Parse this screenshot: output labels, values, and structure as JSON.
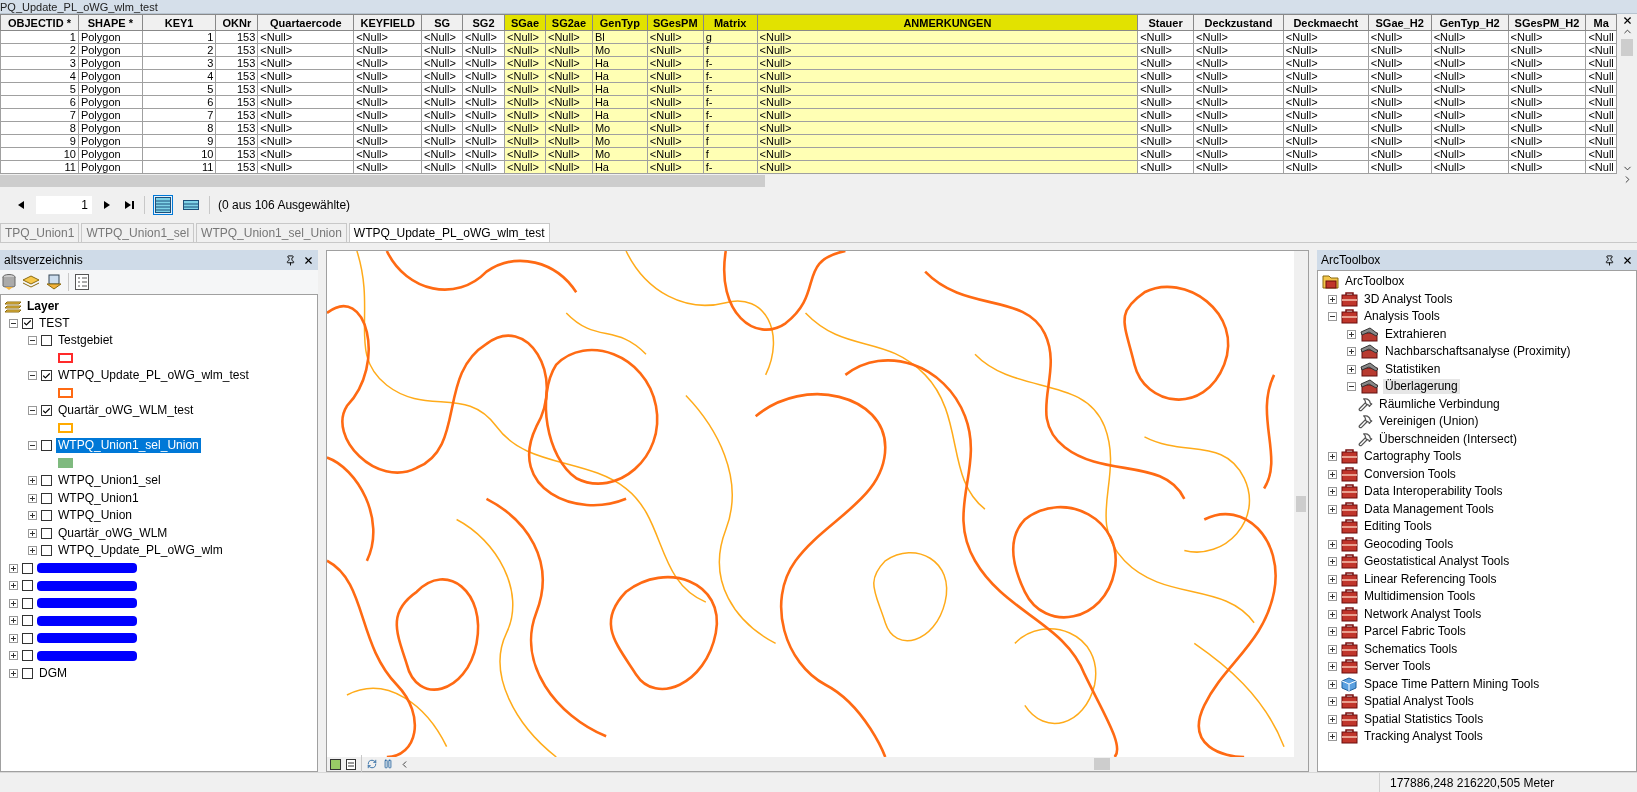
{
  "window": {
    "title": "PQ_Update_PL_oWG_wlm_test"
  },
  "table": {
    "columns": [
      {
        "label": "OBJECTID *",
        "highlighted": false
      },
      {
        "label": "SHAPE *",
        "highlighted": false
      },
      {
        "label": "KEY1",
        "highlighted": false
      },
      {
        "label": "OKNr",
        "highlighted": false
      },
      {
        "label": "Quartaercode",
        "highlighted": false
      },
      {
        "label": "KEYFIELD",
        "highlighted": false
      },
      {
        "label": "SG",
        "highlighted": false
      },
      {
        "label": "SG2",
        "highlighted": false
      },
      {
        "label": "SGae",
        "highlighted": true
      },
      {
        "label": "SG2ae",
        "highlighted": true
      },
      {
        "label": "GenTyp",
        "highlighted": true
      },
      {
        "label": "SGesPM",
        "highlighted": true
      },
      {
        "label": "Matrix",
        "highlighted": true
      },
      {
        "label": "ANMERKUNGEN",
        "highlighted": true
      },
      {
        "label": "Stauer",
        "highlighted": false
      },
      {
        "label": "Deckzustand",
        "highlighted": false
      },
      {
        "label": "Deckmaecht",
        "highlighted": false
      },
      {
        "label": "SGae_H2",
        "highlighted": false
      },
      {
        "label": "GenTyp_H2",
        "highlighted": false
      },
      {
        "label": "SGesPM_H2",
        "highlighted": false
      },
      {
        "label": "Ma",
        "highlighted": false
      }
    ],
    "rows": [
      [
        "1",
        "Polygon",
        "1",
        "153",
        "<Null>",
        "<Null>",
        "<Null>",
        "<Null>",
        "<Null>",
        "<Null>",
        "Bl",
        "<Null>",
        "g",
        "<Null>",
        "<Null>",
        "<Null>",
        "<Null>",
        "<Null>",
        "<Null>",
        "<Null>",
        "<Null"
      ],
      [
        "2",
        "Polygon",
        "2",
        "153",
        "<Null>",
        "<Null>",
        "<Null>",
        "<Null>",
        "<Null>",
        "<Null>",
        "Mo",
        "<Null>",
        "f",
        "<Null>",
        "<Null>",
        "<Null>",
        "<Null>",
        "<Null>",
        "<Null>",
        "<Null>",
        "<Null"
      ],
      [
        "3",
        "Polygon",
        "3",
        "153",
        "<Null>",
        "<Null>",
        "<Null>",
        "<Null>",
        "<Null>",
        "<Null>",
        "Ha",
        "<Null>",
        "f-",
        "<Null>",
        "<Null>",
        "<Null>",
        "<Null>",
        "<Null>",
        "<Null>",
        "<Null>",
        "<Null"
      ],
      [
        "4",
        "Polygon",
        "4",
        "153",
        "<Null>",
        "<Null>",
        "<Null>",
        "<Null>",
        "<Null>",
        "<Null>",
        "Ha",
        "<Null>",
        "f-",
        "<Null>",
        "<Null>",
        "<Null>",
        "<Null>",
        "<Null>",
        "<Null>",
        "<Null>",
        "<Null"
      ],
      [
        "5",
        "Polygon",
        "5",
        "153",
        "<Null>",
        "<Null>",
        "<Null>",
        "<Null>",
        "<Null>",
        "<Null>",
        "Ha",
        "<Null>",
        "f-",
        "<Null>",
        "<Null>",
        "<Null>",
        "<Null>",
        "<Null>",
        "<Null>",
        "<Null>",
        "<Null"
      ],
      [
        "6",
        "Polygon",
        "6",
        "153",
        "<Null>",
        "<Null>",
        "<Null>",
        "<Null>",
        "<Null>",
        "<Null>",
        "Ha",
        "<Null>",
        "f-",
        "<Null>",
        "<Null>",
        "<Null>",
        "<Null>",
        "<Null>",
        "<Null>",
        "<Null>",
        "<Null"
      ],
      [
        "7",
        "Polygon",
        "7",
        "153",
        "<Null>",
        "<Null>",
        "<Null>",
        "<Null>",
        "<Null>",
        "<Null>",
        "Ha",
        "<Null>",
        "f-",
        "<Null>",
        "<Null>",
        "<Null>",
        "<Null>",
        "<Null>",
        "<Null>",
        "<Null>",
        "<Null"
      ],
      [
        "8",
        "Polygon",
        "8",
        "153",
        "<Null>",
        "<Null>",
        "<Null>",
        "<Null>",
        "<Null>",
        "<Null>",
        "Mo",
        "<Null>",
        "f",
        "<Null>",
        "<Null>",
        "<Null>",
        "<Null>",
        "<Null>",
        "<Null>",
        "<Null>",
        "<Null"
      ],
      [
        "9",
        "Polygon",
        "9",
        "153",
        "<Null>",
        "<Null>",
        "<Null>",
        "<Null>",
        "<Null>",
        "<Null>",
        "Mo",
        "<Null>",
        "f",
        "<Null>",
        "<Null>",
        "<Null>",
        "<Null>",
        "<Null>",
        "<Null>",
        "<Null>",
        "<Null"
      ],
      [
        "10",
        "Polygon",
        "10",
        "153",
        "<Null>",
        "<Null>",
        "<Null>",
        "<Null>",
        "<Null>",
        "<Null>",
        "Mo",
        "<Null>",
        "f",
        "<Null>",
        "<Null>",
        "<Null>",
        "<Null>",
        "<Null>",
        "<Null>",
        "<Null>",
        "<Null"
      ],
      [
        "11",
        "Polygon",
        "11",
        "153",
        "<Null>",
        "<Null>",
        "<Null>",
        "<Null>",
        "<Null>",
        "<Null>",
        "Ha",
        "<Null>",
        "f-",
        "<Null>",
        "<Null>",
        "<Null>",
        "<Null>",
        "<Null>",
        "<Null>",
        "<Null>",
        "<Null"
      ]
    ]
  },
  "navigator": {
    "record": "1",
    "views": [
      {
        "selected": true
      },
      {
        "selected": false
      }
    ],
    "selection_info": "(0 aus 106 Ausgewählte)"
  },
  "tabs": [
    {
      "label": "TPQ_Union1",
      "selected": false
    },
    {
      "label": "WTPQ_Union1_sel",
      "selected": false
    },
    {
      "label": "WTPQ_Union1_sel_Union",
      "selected": false
    },
    {
      "label": "WTPQ_Update_PL_oWG_wlm_test",
      "selected": true
    }
  ],
  "toc": {
    "title": "altsverzeichnis",
    "root": {
      "label": "Layer",
      "children": [
        {
          "kind": "group",
          "label": "TEST",
          "checked": true,
          "expanded": true,
          "selected": false,
          "children": [
            {
              "kind": "layer",
              "label": "Testgebiet",
              "checked": false,
              "expanded": true,
              "selected": false,
              "symbol": {
                "color": "#ff2a2a",
                "filled": false
              }
            },
            {
              "kind": "layer",
              "label": "WTPQ_Update_PL_oWG_wlm_test",
              "checked": true,
              "expanded": true,
              "selected": false,
              "symbol": {
                "color": "#ff6a13",
                "filled": false
              }
            },
            {
              "kind": "layer",
              "label": "Quartär_oWG_WLM_test",
              "checked": true,
              "expanded": true,
              "selected": false,
              "symbol": {
                "color": "#ffaa00",
                "filled": false
              }
            },
            {
              "kind": "layer",
              "label": "WTPQ_Union1_sel_Union",
              "checked": false,
              "expanded": true,
              "selected": true,
              "symbol": {
                "color": "#7fba7f",
                "filled": true
              }
            },
            {
              "kind": "layer",
              "label": "WTPQ_Union1_sel",
              "checked": false,
              "expanded": false,
              "selected": false
            },
            {
              "kind": "layer",
              "label": "WTPQ_Union1",
              "checked": false,
              "expanded": false,
              "selected": false
            },
            {
              "kind": "layer",
              "label": "WTPQ_Union",
              "checked": false,
              "expanded": false,
              "selected": false
            },
            {
              "kind": "layer",
              "label": "Quartär_oWG_WLM",
              "checked": false,
              "expanded": false,
              "selected": false
            },
            {
              "kind": "layer",
              "label": "WTPQ_Update_PL_oWG_wlm",
              "checked": false,
              "expanded": false,
              "selected": false
            }
          ]
        },
        {
          "kind": "redacted",
          "checked": false,
          "expanded": false
        },
        {
          "kind": "redacted",
          "checked": false,
          "expanded": false
        },
        {
          "kind": "redacted",
          "checked": false,
          "expanded": false
        },
        {
          "kind": "redacted",
          "checked": false,
          "expanded": false
        },
        {
          "kind": "redacted",
          "checked": false,
          "expanded": false
        },
        {
          "kind": "redacted",
          "checked": false,
          "expanded": false
        },
        {
          "kind": "group",
          "label": "DGM",
          "checked": false,
          "expanded": false,
          "selected": false
        }
      ]
    }
  },
  "toolbox": {
    "title": "ArcToolbox",
    "root": {
      "label": "ArcToolbox",
      "children": [
        {
          "kind": "toolbox",
          "label": "3D Analyst Tools",
          "expandable": true,
          "expanded": false,
          "selected": false
        },
        {
          "kind": "toolbox",
          "label": "Analysis Tools",
          "expandable": true,
          "expanded": true,
          "selected": false,
          "children": [
            {
              "kind": "toolset",
              "label": "Extrahieren",
              "expandable": true,
              "expanded": false,
              "selected": false
            },
            {
              "kind": "toolset",
              "label": "Nachbarschaftsanalyse (Proximity)",
              "expandable": true,
              "expanded": false,
              "selected": false
            },
            {
              "kind": "toolset",
              "label": "Statistiken",
              "expandable": true,
              "expanded": false,
              "selected": false
            },
            {
              "kind": "toolset",
              "label": "Überlagerung",
              "expandable": true,
              "expanded": true,
              "selected": true,
              "children": [
                {
                  "kind": "tool",
                  "label": "Räumliche Verbindung",
                  "selected": false
                },
                {
                  "kind": "tool",
                  "label": "Vereinigen (Union)",
                  "selected": false
                },
                {
                  "kind": "tool",
                  "label": "Überschneiden (Intersect)",
                  "selected": false
                }
              ]
            }
          ]
        },
        {
          "kind": "toolbox",
          "label": "Cartography Tools",
          "expandable": true,
          "expanded": false,
          "selected": false
        },
        {
          "kind": "toolbox",
          "label": "Conversion Tools",
          "expandable": true,
          "expanded": false,
          "selected": false
        },
        {
          "kind": "toolbox",
          "label": "Data Interoperability Tools",
          "expandable": true,
          "expanded": false,
          "selected": false
        },
        {
          "kind": "toolbox",
          "label": "Data Management Tools",
          "expandable": true,
          "expanded": false,
          "selected": false
        },
        {
          "kind": "toolbox",
          "label": "Editing Tools",
          "expandable": false,
          "selected": false
        },
        {
          "kind": "toolbox",
          "label": "Geocoding Tools",
          "expandable": true,
          "expanded": false,
          "selected": false
        },
        {
          "kind": "toolbox",
          "label": "Geostatistical Analyst Tools",
          "expandable": true,
          "expanded": false,
          "selected": false
        },
        {
          "kind": "toolbox",
          "label": "Linear Referencing Tools",
          "expandable": true,
          "expanded": false,
          "selected": false
        },
        {
          "kind": "toolbox",
          "label": "Multidimension Tools",
          "expandable": true,
          "expanded": false,
          "selected": false
        },
        {
          "kind": "toolbox",
          "label": "Network Analyst Tools",
          "expandable": true,
          "expanded": false,
          "selected": false
        },
        {
          "kind": "toolbox",
          "label": "Parcel Fabric Tools",
          "expandable": true,
          "expanded": false,
          "selected": false
        },
        {
          "kind": "toolbox",
          "label": "Schematics Tools",
          "expandable": true,
          "expanded": false,
          "selected": false
        },
        {
          "kind": "toolbox",
          "label": "Server Tools",
          "expandable": true,
          "expanded": false,
          "selected": false
        },
        {
          "kind": "script-toolbox",
          "label": "Space Time Pattern Mining Tools",
          "expandable": true,
          "expanded": false,
          "selected": false
        },
        {
          "kind": "toolbox",
          "label": "Spatial Analyst Tools",
          "expandable": true,
          "expanded": false,
          "selected": false
        },
        {
          "kind": "toolbox",
          "label": "Spatial Statistics Tools",
          "expandable": true,
          "expanded": false,
          "selected": false
        },
        {
          "kind": "toolbox",
          "label": "Tracking Analyst Tools",
          "expandable": true,
          "expanded": false,
          "selected": false
        }
      ]
    }
  },
  "status_bar": {
    "coordinates": "177886,248  216220,505 Meter"
  }
}
